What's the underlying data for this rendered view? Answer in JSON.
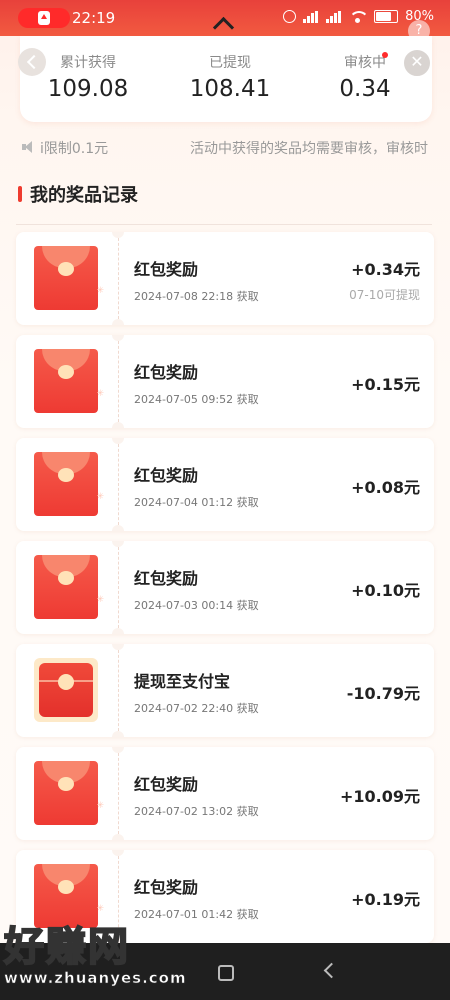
{
  "status_bar": {
    "time": "22:19",
    "battery": "80%"
  },
  "summary": {
    "stats": [
      {
        "label": "累计获得",
        "value": "109.08"
      },
      {
        "label": "已提现",
        "value": "108.41"
      },
      {
        "label": "审核中",
        "value": "0.34"
      }
    ]
  },
  "notice": {
    "text_left": "i限制0.1元",
    "text_right": "活动中获得的奖品均需要审核，审核时"
  },
  "section": {
    "title": "我的奖品记录"
  },
  "records": [
    {
      "title": "红包奖励",
      "date": "2024-07-08 22:18 获取",
      "amount": "+0.34元",
      "note": "07-10可提现",
      "icon": "red-envelope-icon"
    },
    {
      "title": "红包奖励",
      "date": "2024-07-05 09:52 获取",
      "amount": "+0.15元",
      "note": "",
      "icon": "red-envelope-icon"
    },
    {
      "title": "红包奖励",
      "date": "2024-07-04 01:12 获取",
      "amount": "+0.08元",
      "note": "",
      "icon": "red-envelope-icon"
    },
    {
      "title": "红包奖励",
      "date": "2024-07-03 00:14 获取",
      "amount": "+0.10元",
      "note": "",
      "icon": "red-envelope-icon"
    },
    {
      "title": "提现至支付宝",
      "date": "2024-07-02 22:40 获取",
      "amount": "-10.79元",
      "note": "",
      "icon": "withdraw-envelope-icon"
    },
    {
      "title": "红包奖励",
      "date": "2024-07-02 13:02 获取",
      "amount": "+10.09元",
      "note": "",
      "icon": "red-envelope-icon"
    },
    {
      "title": "红包奖励",
      "date": "2024-07-01 01:42 获取",
      "amount": "+0.19元",
      "note": "",
      "icon": "red-envelope-icon"
    }
  ],
  "watermark": {
    "big": "好赚网",
    "small": "www.zhuanyes.com"
  }
}
